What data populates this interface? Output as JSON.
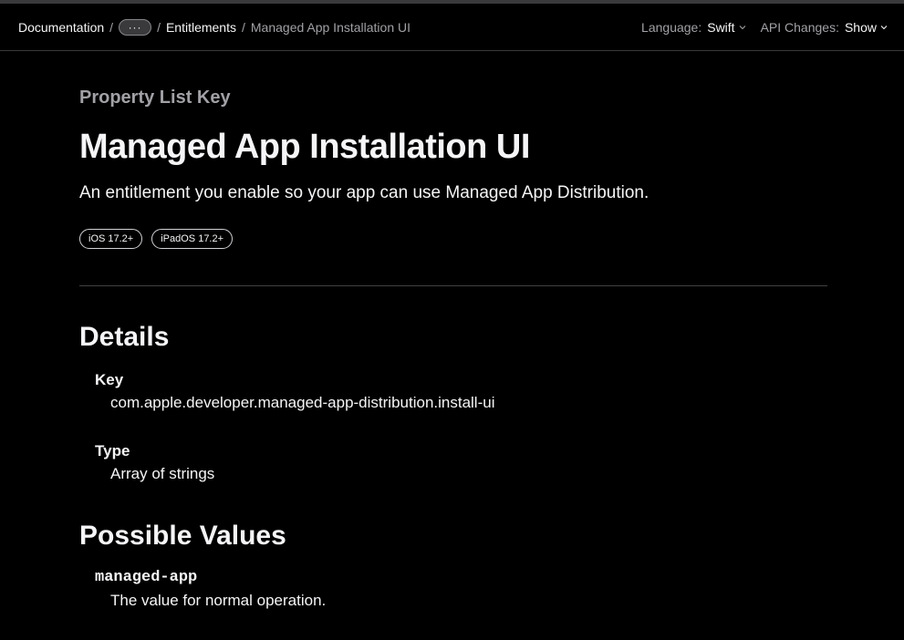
{
  "navbar": {
    "breadcrumb": {
      "root": "Documentation",
      "more": "···",
      "parent": "Entitlements",
      "current": "Managed App Installation UI",
      "separator": "/"
    },
    "language": {
      "label": "Language:",
      "value": "Swift"
    },
    "api_changes": {
      "label": "API Changes:",
      "value": "Show"
    }
  },
  "main": {
    "eyebrow": "Property List Key",
    "title": "Managed App Installation UI",
    "abstract": "An entitlement you enable so your app can use Managed App Distribution.",
    "availability": [
      "iOS 17.2+",
      "iPadOS 17.2+"
    ]
  },
  "details": {
    "heading": "Details",
    "key_label": "Key",
    "key_value": "com.apple.developer.managed-app-distribution.install-ui",
    "type_label": "Type",
    "type_value": "Array of strings"
  },
  "possible_values": {
    "heading": "Possible Values",
    "items": [
      {
        "name": "managed-app",
        "description": "The value for normal operation."
      }
    ]
  },
  "colors": {
    "background": "#000000",
    "text": "#f5f5f7",
    "secondary_text": "#a1a1a6",
    "divider": "#424245"
  },
  "icons": {
    "more": "ellipsis-icon",
    "dropdown": "chevron-down-icon"
  }
}
